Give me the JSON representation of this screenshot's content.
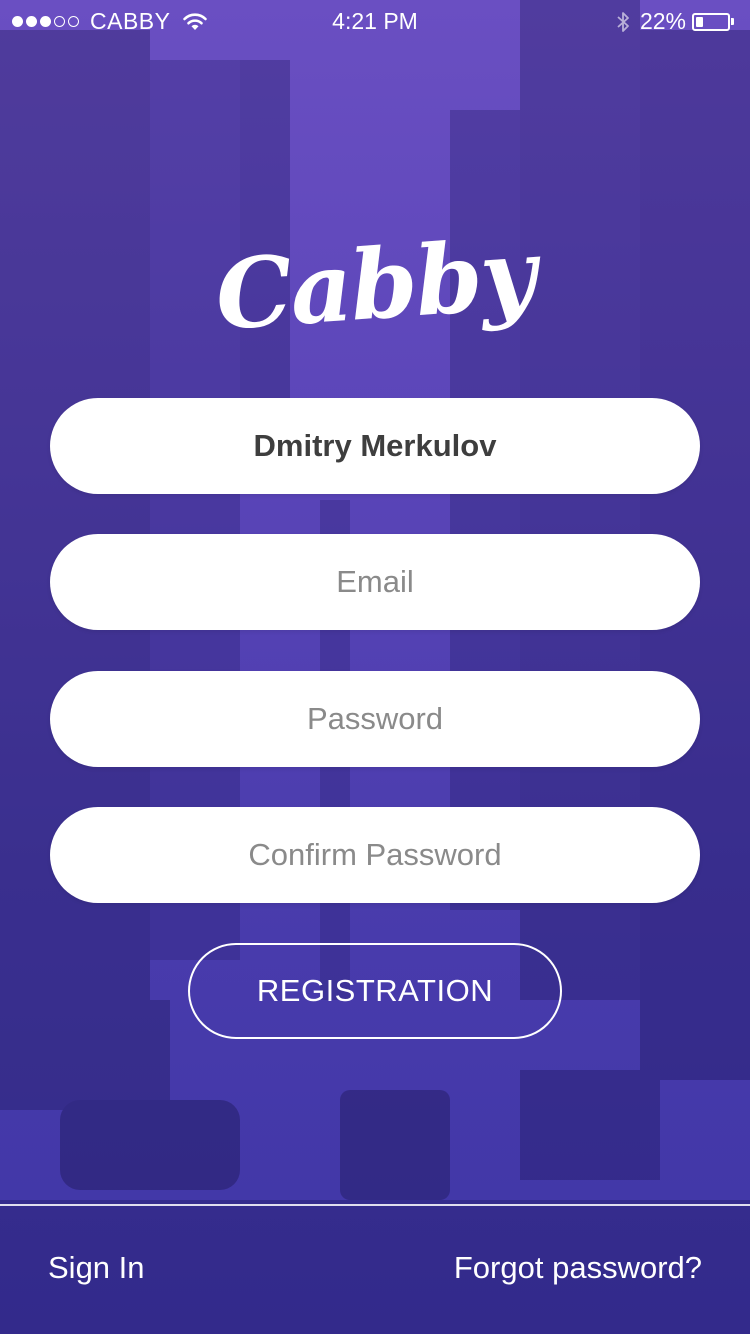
{
  "status_bar": {
    "carrier": "CABBY",
    "time": "4:21 PM",
    "battery_percent_label": "22%",
    "battery_level": 0.22
  },
  "logo": {
    "text": "Cabby"
  },
  "form": {
    "name_value": "Dmitry Merkulov",
    "email_placeholder": "Email",
    "password_placeholder": "Password",
    "confirm_placeholder": "Confirm Password",
    "registration_label": "REGISTRATION"
  },
  "footer": {
    "sign_in_label": "Sign In",
    "forgot_label": "Forgot password?"
  },
  "colors": {
    "background_top": "#6a4fc2",
    "background_bottom": "#3f36a6",
    "field_background": "#ffffff",
    "text_light": "#ffffff"
  },
  "icons": {
    "wifi": "wifi-icon",
    "bluetooth": "bluetooth-icon",
    "battery": "battery-icon"
  }
}
